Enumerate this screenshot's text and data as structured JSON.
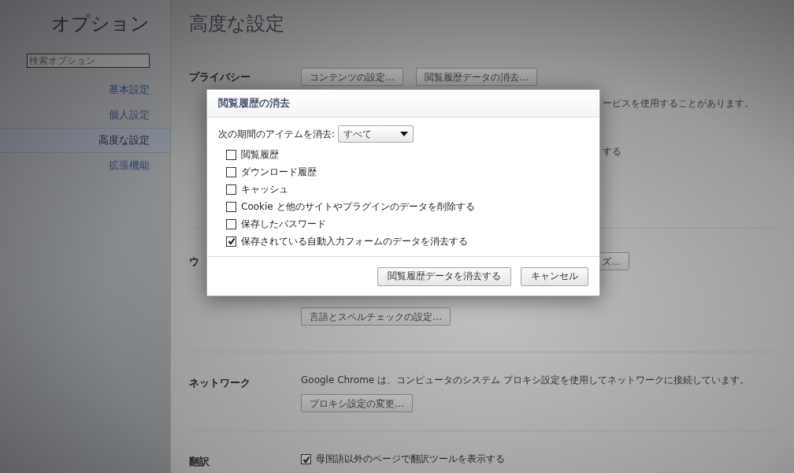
{
  "sidebar": {
    "title": "オプション",
    "search": {
      "placeholder": "検索オプション"
    },
    "items": [
      {
        "label": "基本設定",
        "selected": false
      },
      {
        "label": "個人設定",
        "selected": false
      },
      {
        "label": "高度な設定",
        "selected": true
      },
      {
        "label": "拡張機能",
        "selected": false
      }
    ]
  },
  "page": {
    "title": "高度な設定",
    "sections": [
      {
        "label": "プライバシー",
        "items": [
          {
            "kind": "buttons",
            "buttons": [
              "コンテンツの設定…",
              "閲覧履歴データの消去…"
            ]
          },
          {
            "kind": "peek",
            "text": "ービスを使用することがあります。"
          },
          {
            "kind": "peek",
            "text": "する"
          }
        ]
      },
      {
        "label": "ウ",
        "items": [
          {
            "kind": "peek-button",
            "text": "ズ…"
          },
          {
            "kind": "buttons",
            "buttons": [
              "言語とスペルチェックの設定…"
            ]
          }
        ]
      },
      {
        "label": "ネットワーク",
        "items": [
          {
            "kind": "text",
            "text": "Google Chrome は、コンピュータのシステム プロキシ設定を使用してネットワークに接続しています。"
          },
          {
            "kind": "buttons",
            "buttons": [
              "プロキシ設定の変更…"
            ]
          }
        ]
      },
      {
        "label": "翻訳",
        "items": [
          {
            "kind": "checkbox",
            "text": "母国語以外のページで翻訳ツールを表示する",
            "checked": true
          }
        ]
      }
    ]
  },
  "dialog": {
    "title": "閲覧履歴の消去",
    "period_label": "次の期間のアイテムを消去:",
    "period": "すべて",
    "options": [
      {
        "label": "閲覧履歴",
        "checked": false
      },
      {
        "label": "ダウンロード履歴",
        "checked": false
      },
      {
        "label": "キャッシュ",
        "checked": false
      },
      {
        "label": "Cookie と他のサイトやプラグインのデータを削除する",
        "checked": false
      },
      {
        "label": "保存したパスワード",
        "checked": false
      },
      {
        "label": "保存されている自動入力フォームのデータを消去する",
        "checked": true
      }
    ],
    "buttons": [
      "閲覧履歴データを消去する",
      "キャンセル"
    ]
  }
}
